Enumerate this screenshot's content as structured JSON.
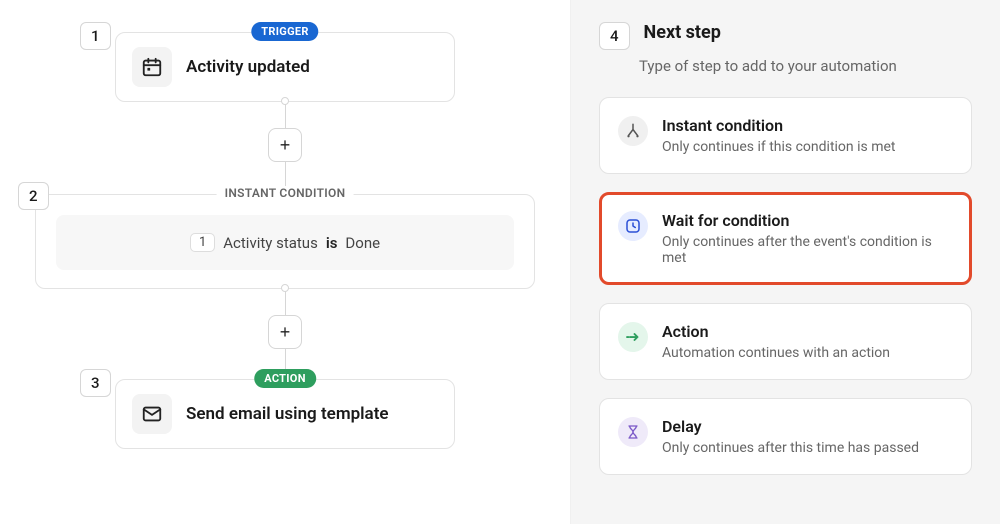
{
  "flow": {
    "step1": {
      "number": "1",
      "pill_label": "TRIGGER",
      "title": "Activity updated"
    },
    "step2": {
      "number": "2",
      "box_label": "INSTANT CONDITION",
      "cond_number": "1",
      "field": "Activity status",
      "op": "is",
      "value": "Done"
    },
    "step3": {
      "number": "3",
      "pill_label": "ACTION",
      "title": "Send email using template"
    },
    "add_label": "+"
  },
  "panel": {
    "step_number": "4",
    "title": "Next step",
    "subtitle": "Type of step to add to your automation",
    "options": [
      {
        "id": "instant",
        "title": "Instant condition",
        "desc": "Only continues if this condition is met",
        "selected": false
      },
      {
        "id": "wait",
        "title": "Wait for condition",
        "desc": "Only continues after the event's condition is met",
        "selected": true
      },
      {
        "id": "action",
        "title": "Action",
        "desc": "Automation continues with an action",
        "selected": false
      },
      {
        "id": "delay",
        "title": "Delay",
        "desc": "Only continues after this time has passed",
        "selected": false
      }
    ]
  }
}
